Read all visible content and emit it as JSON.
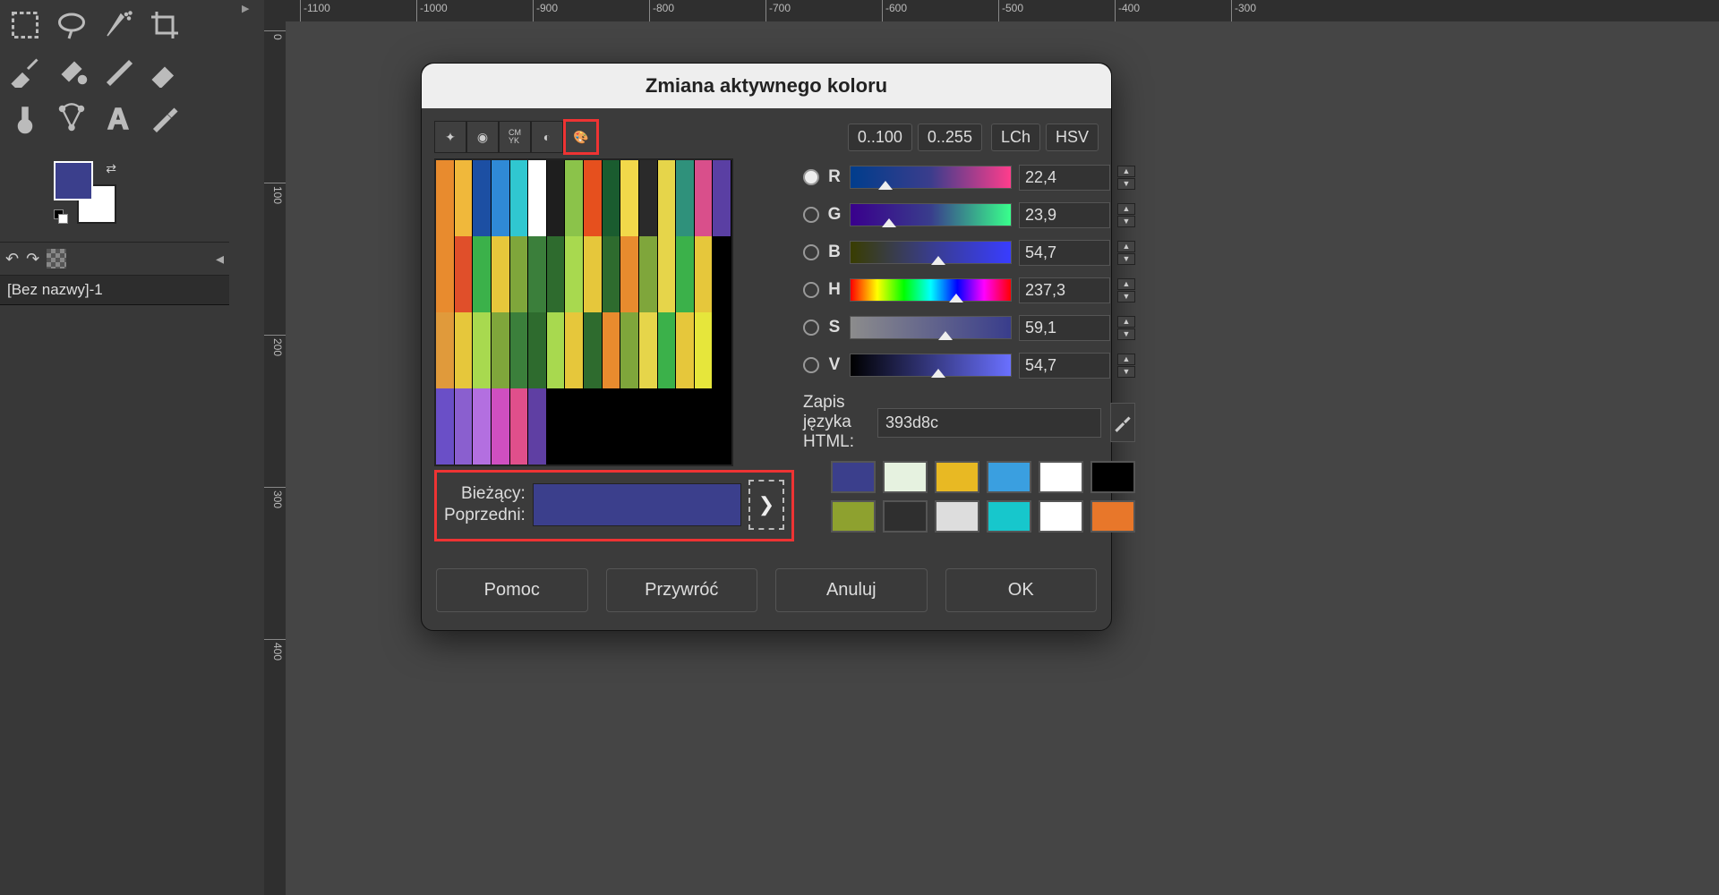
{
  "ruler_h": [
    "-1100",
    "-1000",
    "-900",
    "-800",
    "-700",
    "-600",
    "-500",
    "-400",
    "-300"
  ],
  "ruler_v": [
    "0",
    "100",
    "200",
    "300",
    "400"
  ],
  "layers_tab": "[Bez nazwy]-1",
  "dialog": {
    "title": "Zmiana aktywnego koloru",
    "range_a": "0..100",
    "range_b": "0..255",
    "model_a": "LCh",
    "model_b": "HSV",
    "sliders": {
      "R": {
        "label": "R",
        "value": "22,4",
        "pos": 22
      },
      "G": {
        "label": "G",
        "value": "23,9",
        "pos": 24
      },
      "B": {
        "label": "B",
        "value": "54,7",
        "pos": 55
      },
      "H": {
        "label": "H",
        "value": "237,3",
        "pos": 66
      },
      "S": {
        "label": "S",
        "value": "59,1",
        "pos": 59
      },
      "V": {
        "label": "V",
        "value": "54,7",
        "pos": 55
      }
    },
    "html_label": "Zapis języka HTML:",
    "html_value": "393d8c",
    "current_label": "Bieżący:",
    "previous_label": "Poprzedni:",
    "recent": [
      "#3b3f8c",
      "#e6f2e0",
      "#e8b923",
      "#3a9fe0",
      "#ffffff",
      "#000000",
      "#8ea12f",
      "#2f2f2f",
      "#dddddd",
      "#17c7cc",
      "#ffffff",
      "#e8772a"
    ],
    "buttons": {
      "help": "Pomoc",
      "reset": "Przywróć",
      "cancel": "Anuluj",
      "ok": "OK"
    }
  },
  "palette_colors": [
    "#e88b2e",
    "#f0b83b",
    "#1c4fa3",
    "#2f8ad6",
    "#30c7d0",
    "#ffffff",
    "#1e1e1e",
    "#8bc34a",
    "#e6501e",
    "#1a5c2f",
    "#f2d84a",
    "#2a2a2a",
    "#e6d54a",
    "#2f917b",
    "#d94f8b",
    "#5a3fa3",
    "#e88b2e",
    "#e04f2a",
    "#3bb14a",
    "#e6c73b",
    "#7fa63b",
    "#3b7f3b",
    "#2e6b2e",
    "#a8d94f",
    "#e6c73b",
    "#2e6b2e",
    "#e88b2e",
    "#7fa63b",
    "#e6d54a",
    "#3bb14a",
    "#e6c73b",
    "#000000",
    "#e09a3b",
    "#e6c73b",
    "#a8d94f",
    "#7fa63b",
    "#3b7f3b",
    "#2e6b2e",
    "#a8d94f",
    "#e6c73b",
    "#2e6b2e",
    "#e88b2e",
    "#7fa63b",
    "#e6d54a",
    "#3bb14a",
    "#e6c73b",
    "#e6e63b",
    "#000000",
    "#6a4fc7",
    "#8a5fcf",
    "#b36fe0",
    "#cf4fc0",
    "#e04f8b",
    "#5f3fa3",
    "#000000",
    "#000000",
    "#000000",
    "#000000",
    "#000000",
    "#000000",
    "#000000",
    "#000000",
    "#000000",
    "#000000"
  ]
}
